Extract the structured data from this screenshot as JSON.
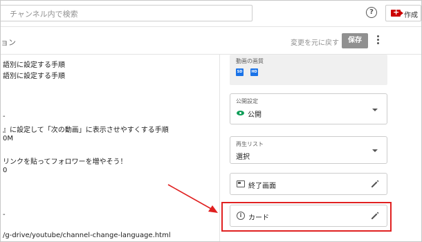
{
  "search": {
    "placeholder": "チャンネル内で検索"
  },
  "header": {
    "help_icon": "help-icon",
    "create_label": "作成"
  },
  "subbar": {
    "title": "ョン",
    "revert_label": "変更を元に戻す",
    "save_label": "保存"
  },
  "description_lines": [
    "語別に設定する手順",
    "語別に設定する手順",
    "-",
    "』に設定して「次の動画」に表示させやすくする手順",
    "0M",
    "リンクを貼ってフォロワーを増やそう！",
    "0",
    "-",
    "/g-drive/youtube/channel-change-language.html"
  ],
  "quality": {
    "label": "動画の画質",
    "badges": [
      "SD",
      "HD"
    ]
  },
  "visibility": {
    "label": "公開設定",
    "value": "公開"
  },
  "playlist": {
    "label": "再生リスト",
    "value": "選択"
  },
  "end_screen": {
    "label": "終了画面"
  },
  "cards": {
    "label": "カード"
  },
  "colors": {
    "highlight": "#e02020",
    "arrow": "#e02020",
    "accent": "#1a73e8",
    "public_icon": "#0f9d58",
    "save_bg": "#909090"
  }
}
